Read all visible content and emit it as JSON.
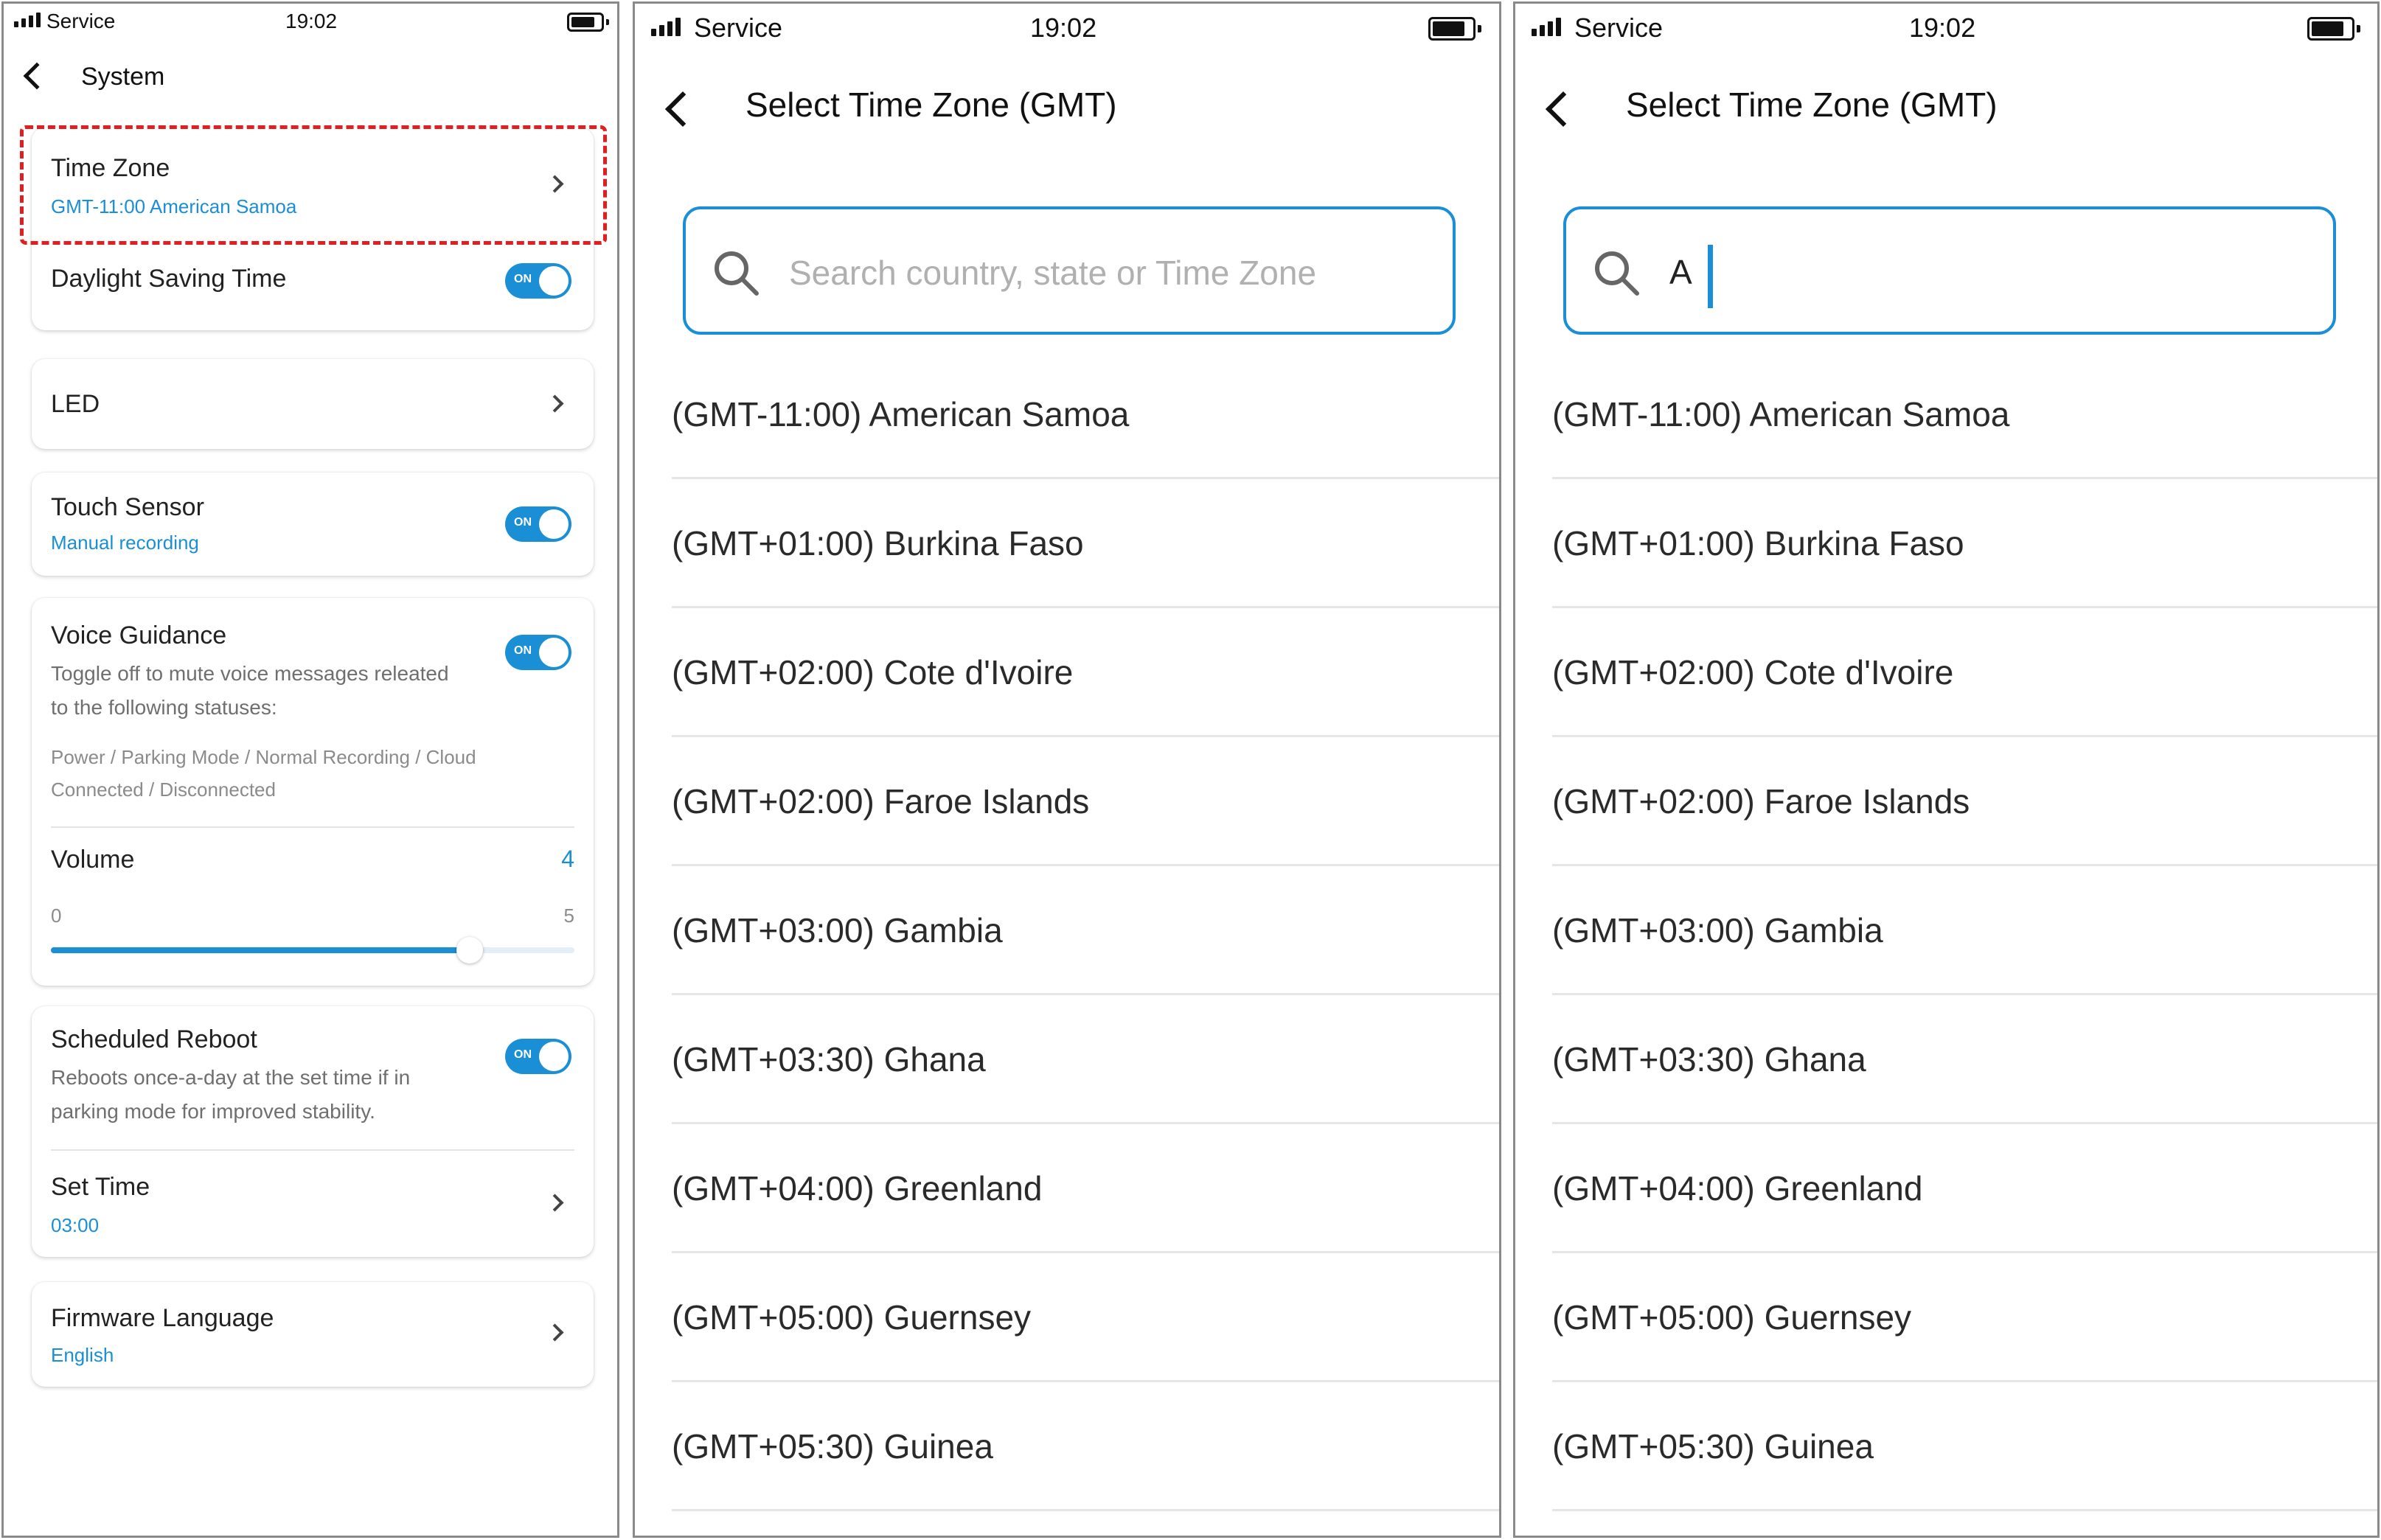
{
  "status_bar": {
    "carrier": "Service",
    "time": "19:02"
  },
  "system": {
    "title": "System",
    "time_zone": {
      "label": "Time Zone",
      "value": "GMT-11:00 American Samoa"
    },
    "daylight_saving": {
      "label": "Daylight Saving Time",
      "on": true
    },
    "led": {
      "label": "LED"
    },
    "touch_sensor": {
      "label": "Touch Sensor",
      "value": "Manual recording",
      "on": true
    },
    "voice_guidance": {
      "label": "Voice Guidance",
      "description": "Toggle off to mute voice messages releated to the following statuses:",
      "statuses": "Power / Parking Mode / Normal Recording / Cloud Connected / Disconnected",
      "on": true
    },
    "volume": {
      "label": "Volume",
      "value": "4",
      "min": "0",
      "max": "5",
      "fraction": 0.8
    },
    "scheduled_reboot": {
      "label": "Scheduled Reboot",
      "description": "Reboots once-a-day at the set time if in parking mode for improved stability.",
      "on": true
    },
    "set_time": {
      "label": "Set Time",
      "value": "03:00"
    },
    "firmware_language": {
      "label": "Firmware Language",
      "value": "English"
    },
    "toggle_on_text": "ON"
  },
  "timezone_screen": {
    "title": "Select Time Zone (GMT)",
    "search_placeholder": "Search country, state or Time Zone",
    "search_typed_value": "A",
    "items": [
      "(GMT-11:00) American Samoa",
      "(GMT+01:00) Burkina Faso",
      "(GMT+02:00) Cote d'Ivoire",
      "(GMT+02:00) Faroe Islands",
      "(GMT+03:00) Gambia",
      "(GMT+03:30) Ghana",
      "(GMT+04:00) Greenland",
      "(GMT+05:00) Guernsey",
      "(GMT+05:30) Guinea"
    ]
  },
  "colors": {
    "accent": "#1a8fd6",
    "highlight": "#e02020"
  }
}
